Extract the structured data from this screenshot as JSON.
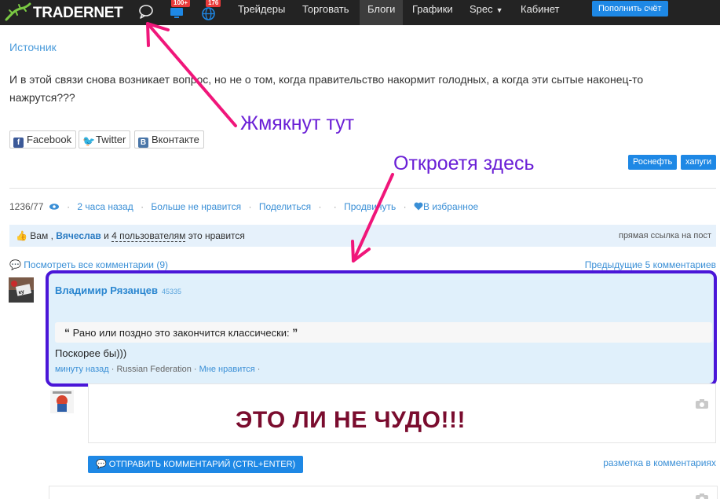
{
  "navbar": {
    "logo": "TRADERNET",
    "badges": {
      "notifications": "100+",
      "world": "176"
    },
    "items": [
      {
        "label": "Трейдеры",
        "active": false
      },
      {
        "label": "Торговать",
        "active": false
      },
      {
        "label": "Блоги",
        "active": true
      },
      {
        "label": "Графики",
        "active": false
      },
      {
        "label": "Spec",
        "active": false,
        "has_dropdown": true
      },
      {
        "label": "Кабинет",
        "active": false
      }
    ],
    "topup_label": "Пополнить счёт",
    "icons": [
      "logo-lizard-icon",
      "chat-bubble-icon",
      "monitor-icon",
      "globe-icon"
    ]
  },
  "post": {
    "source_label": "Источник",
    "text": "И в этой связи снова возникает вопрос, но не о том, когда правительство накормит голодных, а когда эти сытые наконец-то нажрутся???",
    "share": {
      "facebook": "Facebook",
      "twitter": "Twitter",
      "vk": "Вконтакте"
    },
    "tags": [
      "Роснефть",
      "хапуги"
    ],
    "meta": {
      "views": "1236/77",
      "time": "2 часа назад",
      "dislike": "Больше не нравится",
      "share": "Поделиться",
      "promote": "Продвинуть",
      "favorite": "В избранное"
    },
    "likes": {
      "you": "Вам",
      "name": "Вячеслав",
      "and": "и",
      "others": "4 пользователям",
      "suffix": "это нравится",
      "direct_link": "прямая ссылка на пост"
    }
  },
  "comments": {
    "view_all": "Посмотреть все комментарии (9)",
    "prev": "Предыдущие 5 комментариев",
    "items": [
      {
        "author": "Владимир Рязанцев",
        "rating": "45335",
        "quote": "Рано или поздно это закончится классически:",
        "text": "Поскорее бы)))",
        "time": "минуту назад",
        "location": "Russian Federation",
        "like": "Мне нравится"
      }
    ],
    "send_label": "ОТПРАВИТЬ КОММЕНТАРИЙ (CTRL+ENTER)",
    "markup_label": "разметка в комментариях"
  },
  "annotations": {
    "click_here": "Жмякнут тут",
    "opens_here": "Откроетя здесь",
    "miracle": "ЭТО ЛИ НЕ ЧУДО!!!"
  },
  "colors": {
    "navbar": "#232323",
    "accent": "#1e88e5",
    "link": "#3a8fd6",
    "annotation_arrow": "#f0167a",
    "annotation_text": "#6a1fd6",
    "highlight_border": "#4a16d8",
    "miracle_text": "#7a0c2e"
  }
}
